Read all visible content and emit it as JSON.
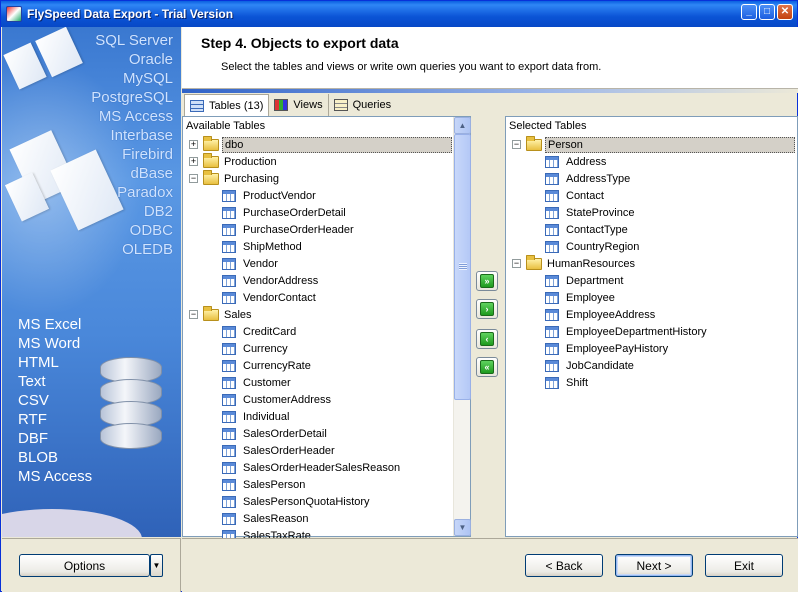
{
  "window": {
    "title": "FlySpeed Data Export - Trial Version"
  },
  "banner": {
    "sources": [
      "SQL Server",
      "Oracle",
      "MySQL",
      "PostgreSQL",
      "MS Access",
      "Interbase",
      "Firebird",
      "dBase",
      "Paradox",
      "DB2",
      "ODBC",
      "OLEDB"
    ],
    "formats": [
      "MS Excel",
      "MS Word",
      "HTML",
      "Text",
      "CSV",
      "RTF",
      "DBF",
      "BLOB",
      "MS Access"
    ]
  },
  "header": {
    "title": "Step 4. Objects to export data",
    "subtitle": "Select the tables and views or write own queries you want to export data from."
  },
  "tabs": [
    {
      "label": "Tables (13)",
      "icon": "table-icon",
      "active": true
    },
    {
      "label": "Views",
      "icon": "views-icon",
      "active": false
    },
    {
      "label": "Queries",
      "icon": "queries-icon",
      "active": false
    }
  ],
  "available": {
    "caption": "Available Tables",
    "groups": [
      {
        "name": "dbo",
        "expanded": false,
        "selected": true,
        "items": []
      },
      {
        "name": "Production",
        "expanded": false,
        "items": []
      },
      {
        "name": "Purchasing",
        "expanded": true,
        "items": [
          "ProductVendor",
          "PurchaseOrderDetail",
          "PurchaseOrderHeader",
          "ShipMethod",
          "Vendor",
          "VendorAddress",
          "VendorContact"
        ]
      },
      {
        "name": "Sales",
        "expanded": true,
        "items": [
          "CreditCard",
          "Currency",
          "CurrencyRate",
          "Customer",
          "CustomerAddress",
          "Individual",
          "SalesOrderDetail",
          "SalesOrderHeader",
          "SalesOrderHeaderSalesReason",
          "SalesPerson",
          "SalesPersonQuotaHistory",
          "SalesReason",
          "SalesTaxRate"
        ]
      }
    ]
  },
  "selected": {
    "caption": "Selected Tables",
    "groups": [
      {
        "name": "Person",
        "expanded": true,
        "selected": true,
        "items": [
          "Address",
          "AddressType",
          "Contact",
          "StateProvince",
          "ContactType",
          "CountryRegion"
        ]
      },
      {
        "name": "HumanResources",
        "expanded": true,
        "items": [
          "Department",
          "Employee",
          "EmployeeAddress",
          "EmployeeDepartmentHistory",
          "EmployeePayHistory",
          "JobCandidate",
          "Shift"
        ]
      }
    ]
  },
  "transfer_buttons": [
    {
      "name": "add-all-button",
      "glyph": "»"
    },
    {
      "name": "add-button",
      "glyph": "›"
    },
    {
      "name": "remove-button",
      "glyph": "‹"
    },
    {
      "name": "remove-all-button",
      "glyph": "«"
    }
  ],
  "footer": {
    "options_label": "Options",
    "back_label": "< Back",
    "next_label": "Next >",
    "exit_label": "Exit"
  }
}
